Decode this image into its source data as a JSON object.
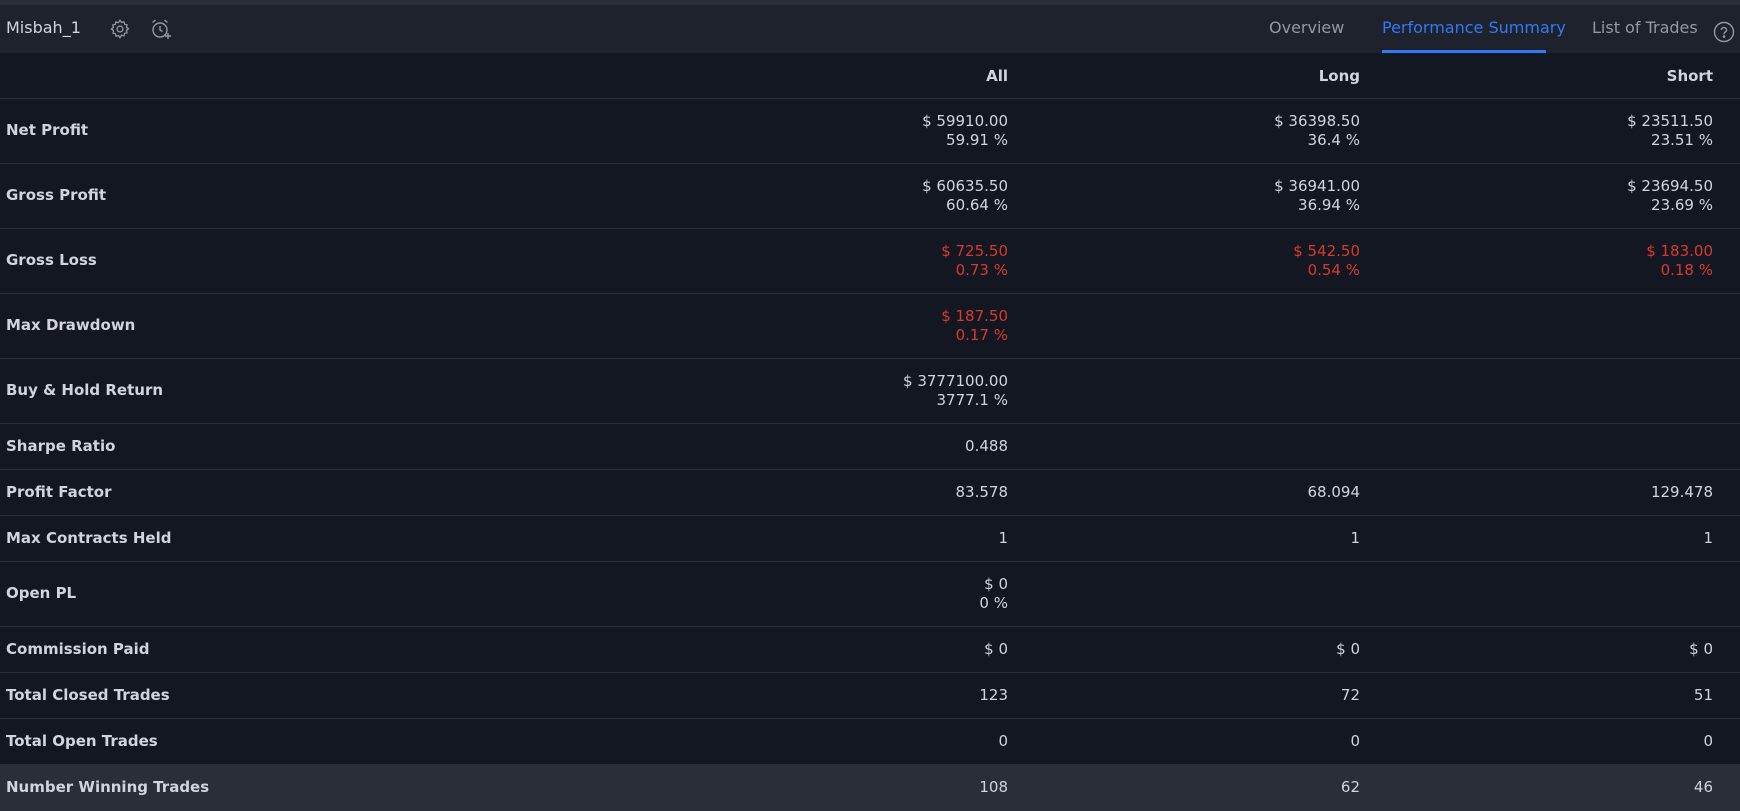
{
  "header": {
    "strategy_name": "Misbah_1",
    "tabs": [
      {
        "label": "Overview",
        "active": false
      },
      {
        "label": "Performance Summary",
        "active": true
      },
      {
        "label": "List of Trades",
        "active": false
      }
    ]
  },
  "table": {
    "columns": [
      "All",
      "Long",
      "Short"
    ],
    "rows": [
      {
        "label": "Net Profit",
        "all": [
          "$ 59910.00",
          "59.91 %"
        ],
        "long": [
          "$ 36398.50",
          "36.4 %"
        ],
        "short": [
          "$ 23511.50",
          "23.51 %"
        ]
      },
      {
        "label": "Gross Profit",
        "all": [
          "$ 60635.50",
          "60.64 %"
        ],
        "long": [
          "$ 36941.00",
          "36.94 %"
        ],
        "short": [
          "$ 23694.50",
          "23.69 %"
        ]
      },
      {
        "label": "Gross Loss",
        "all": [
          "$ 725.50",
          "0.73 %"
        ],
        "long": [
          "$ 542.50",
          "0.54 %"
        ],
        "short": [
          "$ 183.00",
          "0.18 %"
        ]
      },
      {
        "label": "Max Drawdown",
        "all": [
          "$ 187.50",
          "0.17 %"
        ]
      },
      {
        "label": "Buy & Hold Return",
        "all": [
          "$ 3777100.00",
          "3777.1 %"
        ]
      },
      {
        "label": "Sharpe Ratio",
        "all": [
          "0.488"
        ]
      },
      {
        "label": "Profit Factor",
        "all": [
          "83.578"
        ],
        "long": [
          "68.094"
        ],
        "short": [
          "129.478"
        ]
      },
      {
        "label": "Max Contracts Held",
        "all": [
          "1"
        ],
        "long": [
          "1"
        ],
        "short": [
          "1"
        ]
      },
      {
        "label": "Open PL",
        "all": [
          "$ 0",
          "0 %"
        ]
      },
      {
        "label": "Commission Paid",
        "all": [
          "$ 0"
        ],
        "long": [
          "$ 0"
        ],
        "short": [
          "$ 0"
        ]
      },
      {
        "label": "Total Closed Trades",
        "all": [
          "123"
        ],
        "long": [
          "72"
        ],
        "short": [
          "51"
        ]
      },
      {
        "label": "Total Open Trades",
        "all": [
          "0"
        ],
        "long": [
          "0"
        ],
        "short": [
          "0"
        ]
      },
      {
        "label": "Number Winning Trades",
        "all": [
          "108"
        ],
        "long": [
          "62"
        ],
        "short": [
          "46"
        ]
      }
    ]
  },
  "colors": {
    "background": "#131722",
    "topbar": "#1e222d",
    "text": "#d1d4dc",
    "negative": "#d9382c",
    "accent": "#3179f5"
  },
  "icons": {
    "settings": "gear-icon",
    "alert": "alarm-clock-plus-icon",
    "help": "question-circle-icon"
  }
}
